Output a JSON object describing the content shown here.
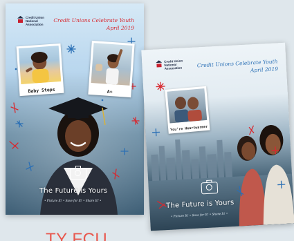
{
  "poster_left": {
    "org_name": "Credit Union National Association",
    "org_lines": [
      "Credit Union",
      "National",
      "Association"
    ],
    "title": "Credit Unions Celebrate Youth",
    "date": "April 2019",
    "photo1_caption": "Baby Steps",
    "photo2_caption": "A+",
    "headline": "The Future is Yours",
    "tagline": "• Picture It! • Save for It! • Share It! •"
  },
  "poster_right": {
    "org_lines": [
      "Credit Union",
      "National",
      "Association"
    ],
    "title": "Credit Unions Celebrate Youth",
    "date": "April 2019",
    "photo_caption": "You’re Heartwarmer",
    "headline": "The Future is Yours",
    "tagline": "• Picture It! • Save for It! • Share It! •"
  },
  "brand_fragment": "TY FCU",
  "colors": {
    "accent_red": "#d8282f",
    "accent_blue": "#2a6fb5",
    "brand_coral": "#e8594f"
  },
  "icons": [
    "camera-icon",
    "sparkle-icon",
    "capitol-logo-icon"
  ]
}
